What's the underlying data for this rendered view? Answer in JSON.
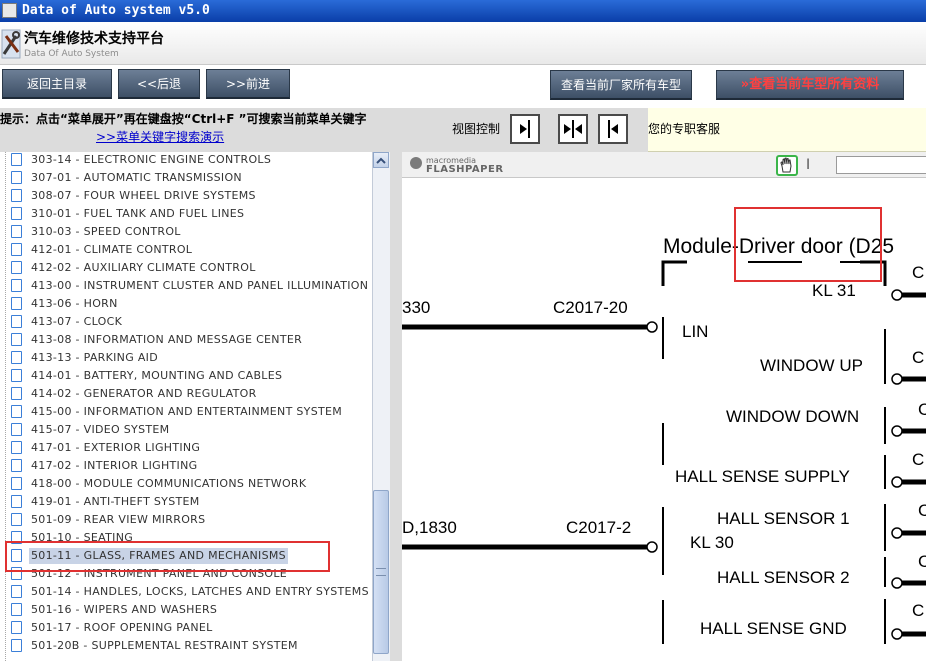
{
  "window": {
    "title": "Data of Auto system v5.0"
  },
  "app": {
    "name": "汽车维修技术支持平台",
    "subtitle": "Data Of Auto System"
  },
  "nav": {
    "home": "返回主目录",
    "back": "<<后退",
    "forward": ">>前进",
    "all_models": "查看当前厂家所有车型",
    "current_model": "查看当前车型所有资料"
  },
  "hint": {
    "text": "提示：点击“菜单展开”再在键盘按“Ctrl+F ”可搜索当前菜单关键字",
    "link": ">>菜单关键字搜索演示"
  },
  "view_control": {
    "label": "视图控制"
  },
  "service": {
    "text": "您的专职客服"
  },
  "tree": {
    "items": [
      {
        "label": "303-14 - ELECTRONIC ENGINE CONTROLS"
      },
      {
        "label": "307-01 - AUTOMATIC TRANSMISSION"
      },
      {
        "label": "308-07 - FOUR WHEEL DRIVE SYSTEMS"
      },
      {
        "label": "310-01 - FUEL TANK AND FUEL LINES"
      },
      {
        "label": "310-03 - SPEED CONTROL"
      },
      {
        "label": "412-01 - CLIMATE CONTROL"
      },
      {
        "label": "412-02 - AUXILIARY CLIMATE CONTROL"
      },
      {
        "label": "413-00 - INSTRUMENT CLUSTER AND PANEL ILLUMINATION"
      },
      {
        "label": "413-06 - HORN"
      },
      {
        "label": "413-07 - CLOCK"
      },
      {
        "label": "413-08 - INFORMATION AND MESSAGE CENTER"
      },
      {
        "label": "413-13 - PARKING AID"
      },
      {
        "label": "414-01 - BATTERY, MOUNTING AND CABLES"
      },
      {
        "label": "414-02 - GENERATOR AND REGULATOR"
      },
      {
        "label": "415-00 - INFORMATION AND ENTERTAINMENT SYSTEM"
      },
      {
        "label": "415-07 - VIDEO SYSTEM"
      },
      {
        "label": "417-01 - EXTERIOR LIGHTING"
      },
      {
        "label": "417-02 - INTERIOR LIGHTING"
      },
      {
        "label": "418-00 - MODULE COMMUNICATIONS NETWORK"
      },
      {
        "label": "419-01 - ANTI-THEFT SYSTEM"
      },
      {
        "label": "501-09 - REAR VIEW MIRRORS"
      },
      {
        "label": "501-10 - SEATING"
      },
      {
        "label": "501-11 - GLASS, FRAMES AND MECHANISMS",
        "selected": true
      },
      {
        "label": "501-12 - INSTRUMENT PANEL AND CONSOLE"
      },
      {
        "label": "501-14 - HANDLES, LOCKS, LATCHES AND ENTRY SYSTEMS"
      },
      {
        "label": "501-16 - WIPERS AND WASHERS"
      },
      {
        "label": "501-17 - ROOF OPENING PANEL"
      },
      {
        "label": "501-20B - SUPPLEMENTAL RESTRAINT SYSTEM"
      }
    ]
  },
  "flashpaper": {
    "brand_top": "macromedia",
    "brand_bottom": "FLASHPAPER"
  },
  "diagram": {
    "title": "Module-Driver door (D25",
    "kl31": "KL 31",
    "kl30": "KL 30",
    "wire_left_1": "330",
    "wire_left_2": "D,1830",
    "conn_1": "C2017-20",
    "conn_2": "C2017-2",
    "pins": [
      "LIN",
      "WINDOW UP",
      "WINDOW DOWN",
      "HALL SENSE SUPPLY",
      "HALL SENSOR 1",
      "HALL SENSOR 2",
      "HALL SENSE GND"
    ],
    "right_c": "C"
  }
}
